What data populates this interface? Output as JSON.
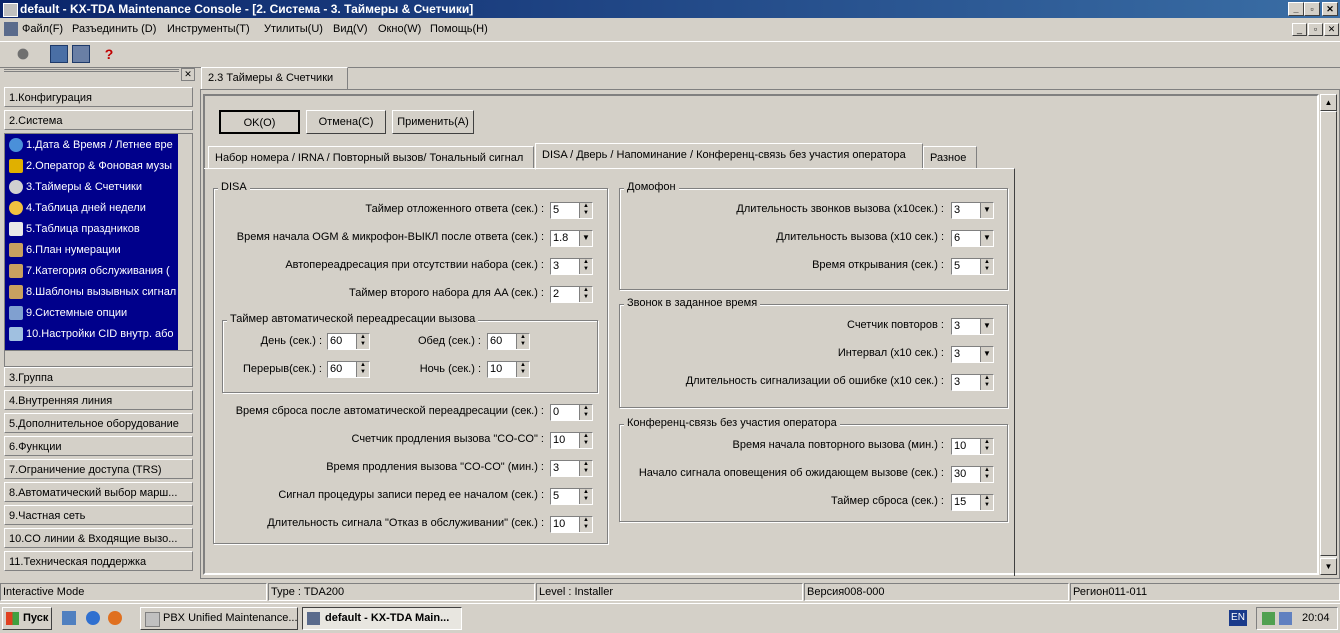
{
  "window": {
    "title": "default - KX-TDA Maintenance Console - [2. Система - 3. Таймеры & Счетчики]"
  },
  "menu": [
    "Файл(F)",
    "Разъединить (D)",
    "Инструменты(T)",
    "Утилиты(U)",
    "Вид(V)",
    "Окно(W)",
    "Помощь(H)"
  ],
  "nav": {
    "top_items": [
      "1.Конфигурация",
      "2.Система"
    ],
    "sub_items": [
      "1.Дата & Время / Летнее вре",
      "2.Оператор & Фоновая музы",
      "3.Таймеры & Счетчики",
      "4.Таблица дней недели",
      "5.Таблица праздников",
      "6.План нумерации",
      "7.Категория обслуживания (",
      "8.Шаблоны вызывных сигнал",
      "9.Системные опции",
      "10.Настройки CID внутр. або"
    ],
    "bottom_items": [
      "3.Группа",
      "4.Внутренняя линия",
      "5.Дополнительное оборудование",
      "6.Функции",
      "7.Ограничение доступа (TRS)",
      "8.Автоматический выбор марш...",
      "9.Частная сеть",
      "10.CO линии & Входящие вызо...",
      "11.Техническая поддержка"
    ]
  },
  "main_tab": "2.3 Таймеры & Счетчики",
  "buttons": {
    "ok": "OK(O)",
    "cancel": "Отмена(C)",
    "apply": "Применить(A)"
  },
  "subtabs": [
    "Набор номера / IRNA / Повторный вызов/ Тональный сигнал",
    "DISA / Дверь / Напоминание / Конференц-связь без участия оператора",
    "Разное"
  ],
  "disa": {
    "title": "DISA",
    "fields": [
      {
        "label": "Таймер отложенного ответа (сек.) :",
        "value": "5"
      },
      {
        "label": "Время начала OGM & микрофон-ВЫКЛ после ответа (сек.) :",
        "value": "1.8"
      },
      {
        "label": "Автопереадресация при отсутствии набора (сек.) :",
        "value": "3"
      },
      {
        "label": "Таймер второго набора для AA (сек.) :",
        "value": "2"
      }
    ],
    "auto_group": {
      "title": "Таймер автоматической переадресации вызова",
      "fields": [
        {
          "label": "День (сек.) :",
          "value": "60"
        },
        {
          "label": "Обед (сек.) :",
          "value": "60"
        },
        {
          "label": "Перерыв(сек.) :",
          "value": "60"
        },
        {
          "label": "Ночь (сек.) :",
          "value": "10"
        }
      ]
    },
    "fields2": [
      {
        "label": "Время сброса после автоматической переадресации (сек.) :",
        "value": "0"
      },
      {
        "label": "Счетчик продления вызова \"CO-CO\" :",
        "value": "10"
      },
      {
        "label": "Время продления вызова \"CO-CO\" (мин.) :",
        "value": "3"
      },
      {
        "label": "Сигнал процедуры записи перед ее началом (сек.) :",
        "value": "5"
      },
      {
        "label": "Длительность сигнала \"Отказ в обслуживании\" (сек.) :",
        "value": "10"
      }
    ]
  },
  "intercom": {
    "title": "Домофон",
    "fields": [
      {
        "label": "Длительность звонков вызова (x10сек.) :",
        "value": "3"
      },
      {
        "label": "Длительность вызова (x10 сек.) :",
        "value": "6"
      },
      {
        "label": "Время открывания (сек.) :",
        "value": "5"
      }
    ]
  },
  "timed": {
    "title": "Звонок в заданное время",
    "fields": [
      {
        "label": "Счетчик повторов :",
        "value": "3"
      },
      {
        "label": "Интервал (x10 сек.) :",
        "value": "3"
      },
      {
        "label": "Длительность сигнализации об ошибке (x10 сек.) :",
        "value": "3"
      }
    ]
  },
  "conf": {
    "title": "Конференц-связь без участия оператора",
    "fields": [
      {
        "label": "Время начала повторного вызова (мин.) :",
        "value": "10"
      },
      {
        "label": "Начало сигнала оповещения об ожидающем вызове (сек.) :",
        "value": "30"
      },
      {
        "label": "Таймер сброса (сек.) :",
        "value": "15"
      }
    ]
  },
  "status": [
    "Interactive Mode",
    "Type : TDA200",
    "Level : Installer",
    "Версия008-000",
    "Регион011-011"
  ],
  "taskbar": {
    "start": "Пуск",
    "tasks": [
      "PBX Unified Maintenance...",
      "default - KX-TDA Main..."
    ],
    "lang": "EN",
    "clock": "20:04"
  }
}
